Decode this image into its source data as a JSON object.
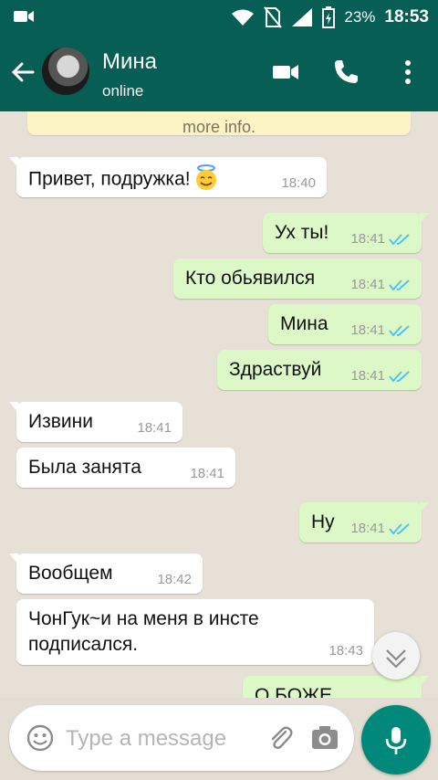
{
  "status_bar": {
    "battery_percent": "23%",
    "time": "18:53"
  },
  "header": {
    "contact_name": "Мина",
    "contact_status": "online"
  },
  "chat": {
    "info_banner": "more info.",
    "messages": [
      {
        "dir": "in",
        "text": "Привет, подружка!",
        "time": "18:40",
        "emoji": "smiling-halo-face"
      },
      {
        "dir": "out",
        "text": "Ух ты!",
        "time": "18:41",
        "status": "read"
      },
      {
        "dir": "out",
        "text": "Кто обьявился",
        "time": "18:41",
        "status": "read"
      },
      {
        "dir": "out",
        "text": "Мина",
        "time": "18:41",
        "status": "read"
      },
      {
        "dir": "out",
        "text": "Здраствуй",
        "time": "18:41",
        "status": "read"
      },
      {
        "dir": "in",
        "text": "Извини",
        "time": "18:41"
      },
      {
        "dir": "in",
        "text": "Была занята",
        "time": "18:41"
      },
      {
        "dir": "out",
        "text": "Ну",
        "time": "18:41",
        "status": "read"
      },
      {
        "dir": "in",
        "text": "Вообщем",
        "time": "18:42"
      },
      {
        "dir": "in",
        "text": "ЧонГук~и на меня в инсте подписался.",
        "time": "18:43"
      },
      {
        "dir": "out",
        "text": "О БОЖЕ",
        "time": "",
        "status": ""
      }
    ]
  },
  "input": {
    "placeholder": "Type a message"
  },
  "colors": {
    "header": "#075e54",
    "outgoing": "#dcf8c6",
    "incoming": "#ffffff",
    "fab": "#00897b",
    "read_ticks": "#4fc3f7"
  }
}
